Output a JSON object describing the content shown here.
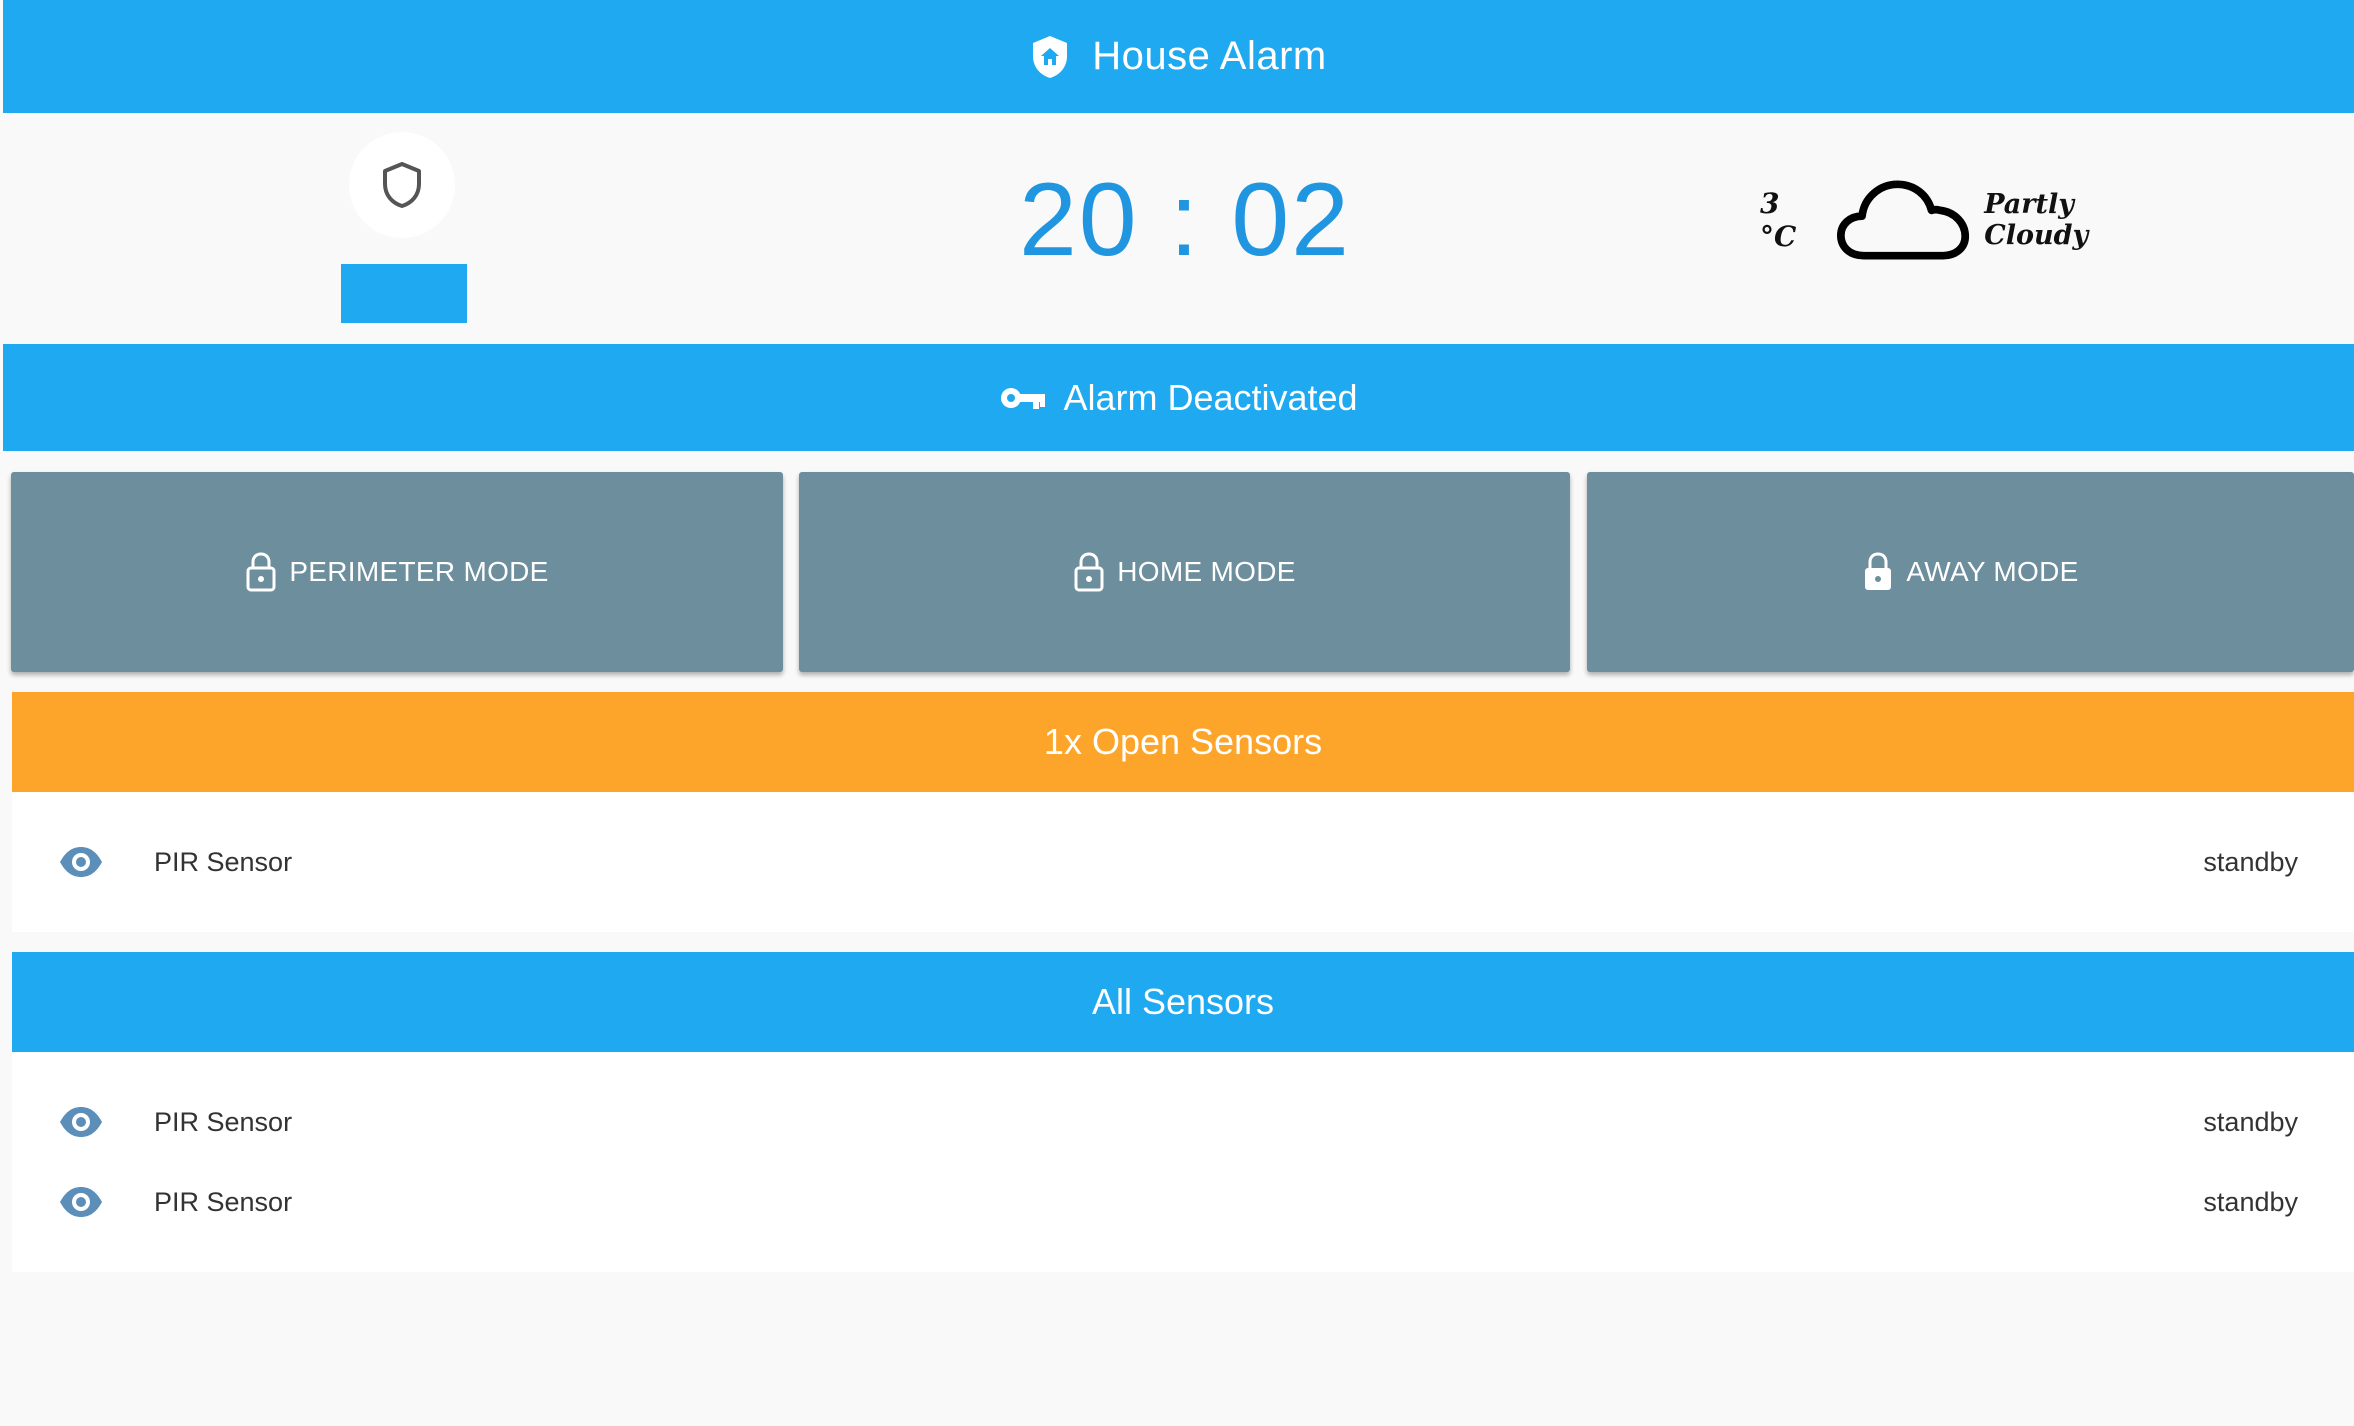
{
  "header": {
    "title": "House Alarm",
    "icon": "home-shield-icon"
  },
  "clock": {
    "time": "20 : 02"
  },
  "weather": {
    "temperature": "3 °C",
    "condition": "Partly Cloudy",
    "icon": "cloud-icon"
  },
  "status": {
    "label": "Alarm Deactivated",
    "icon": "key-icon"
  },
  "modes": [
    {
      "label": "PERIMETER MODE",
      "icon": "lock-open-icon"
    },
    {
      "label": "HOME MODE",
      "icon": "lock-open-icon"
    },
    {
      "label": "AWAY MODE",
      "icon": "lock-icon"
    }
  ],
  "open_sensors": {
    "title": "1x Open Sensors",
    "items": [
      {
        "name": "PIR Sensor",
        "state": "standby"
      }
    ]
  },
  "all_sensors": {
    "title": "All Sensors",
    "items": [
      {
        "name": "PIR Sensor",
        "state": "standby"
      },
      {
        "name": "PIR Sensor",
        "state": "standby"
      }
    ]
  },
  "colors": {
    "primary": "#1fa9f0",
    "warning": "#fda52b",
    "mode_button": "#6c8e9d",
    "clock": "#2196e0"
  }
}
